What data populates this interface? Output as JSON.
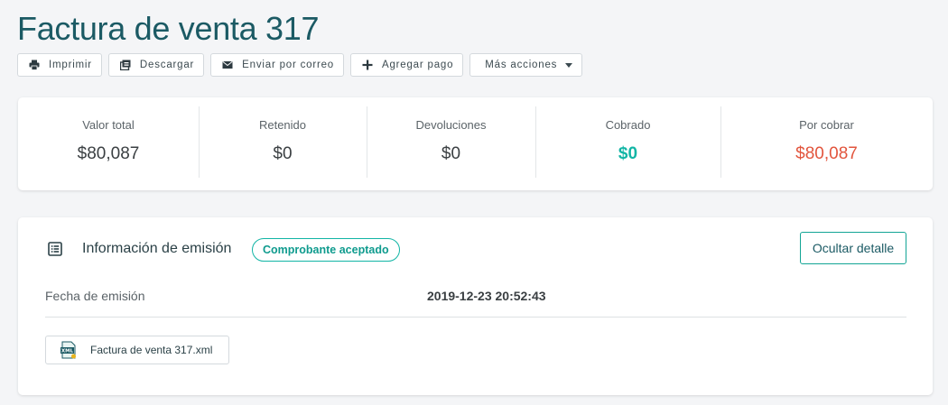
{
  "header": {
    "title": "Factura de venta 317"
  },
  "toolbar": {
    "buttons": [
      {
        "label": "Imprimir",
        "icon": "printer-icon"
      },
      {
        "label": "Descargar",
        "icon": "download-icon"
      },
      {
        "label": "Enviar por correo",
        "icon": "envelope-icon"
      },
      {
        "label": "Agregar pago",
        "icon": "plus-icon"
      },
      {
        "label": "Más acciones",
        "icon": "chevron-down-icon"
      }
    ]
  },
  "summary": {
    "stats": [
      {
        "label": "Valor total",
        "value": "$80,087"
      },
      {
        "label": "Retenido",
        "value": "$0"
      },
      {
        "label": "Devoluciones",
        "value": "$0"
      },
      {
        "label": "Cobrado",
        "value": "$0",
        "color": "#12b5a5"
      },
      {
        "label": "Por cobrar",
        "value": "$80,087",
        "color": "#e2553d"
      }
    ]
  },
  "emission": {
    "title": "Información de emisión",
    "status_badge": "Comprobante aceptado",
    "toggle_label": "Ocultar detalle",
    "date_label": "Fecha de emisión",
    "date_value": "2019-12-23 20:52:43",
    "file": {
      "name": "Factura de venta 317.xml",
      "icon": "xml-file-icon"
    }
  },
  "colors": {
    "brand": "#1b5a64",
    "accent": "#12b5a5",
    "danger": "#e2553d"
  }
}
